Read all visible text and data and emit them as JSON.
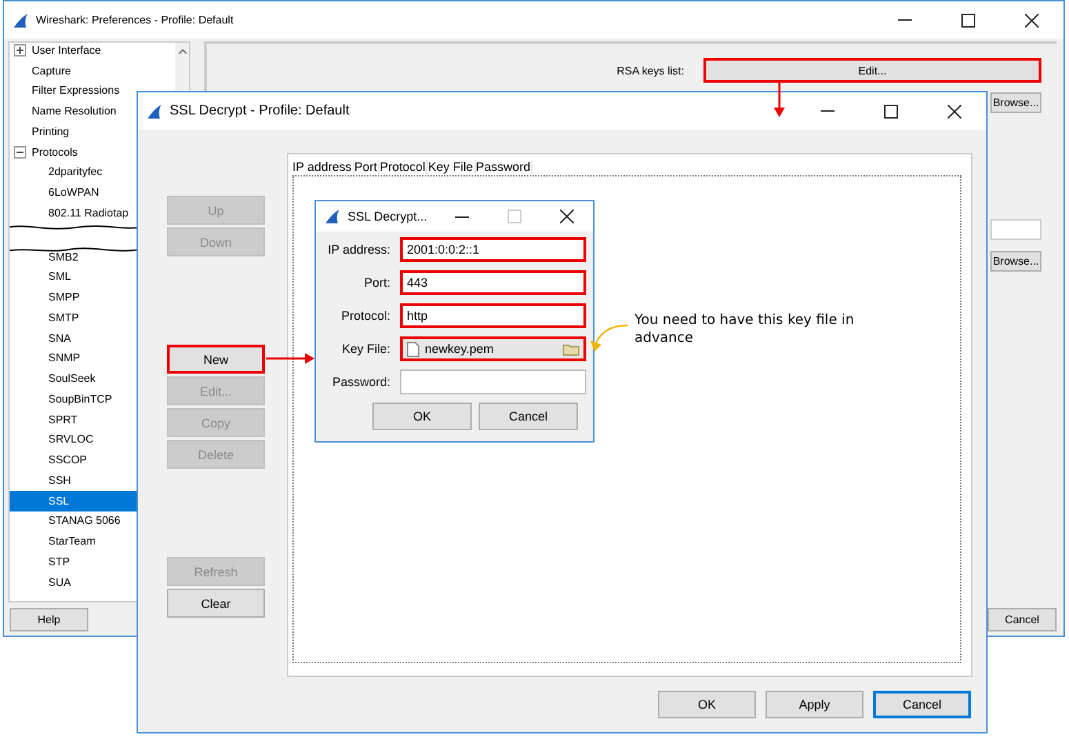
{
  "preferences_window": {
    "title": "Wireshark: Preferences - Profile: Default",
    "tree": [
      {
        "kind": "group",
        "label": "User Interface",
        "expanded": false,
        "selected": false
      },
      {
        "kind": "leaf",
        "label": "Capture",
        "selected": false
      },
      {
        "kind": "leaf",
        "label": "Filter Expressions",
        "selected": false
      },
      {
        "kind": "leaf",
        "label": "Name Resolution",
        "selected": false
      },
      {
        "kind": "leaf",
        "label": "Printing",
        "selected": false
      },
      {
        "kind": "group",
        "label": "Protocols",
        "expanded": true,
        "selected": false,
        "children": [
          {
            "kind": "leaf",
            "label": "2dparityfec",
            "selected": false
          },
          {
            "kind": "leaf",
            "label": "6LoWPAN",
            "selected": false
          },
          {
            "kind": "leaf",
            "label": "802.11 Radiotap",
            "selected": false
          },
          {
            "kind": "break"
          },
          {
            "kind": "leaf",
            "label": "SMB2",
            "selected": false
          },
          {
            "kind": "leaf",
            "label": "SML",
            "selected": false
          },
          {
            "kind": "leaf",
            "label": "SMPP",
            "selected": false
          },
          {
            "kind": "leaf",
            "label": "SMTP",
            "selected": false
          },
          {
            "kind": "leaf",
            "label": "SNA",
            "selected": false
          },
          {
            "kind": "leaf",
            "label": "SNMP",
            "selected": false
          },
          {
            "kind": "leaf",
            "label": "SoulSeek",
            "selected": false
          },
          {
            "kind": "leaf",
            "label": "SoupBinTCP",
            "selected": false
          },
          {
            "kind": "leaf",
            "label": "SPRT",
            "selected": false
          },
          {
            "kind": "leaf",
            "label": "SRVLOC",
            "selected": false
          },
          {
            "kind": "leaf",
            "label": "SSCOP",
            "selected": false
          },
          {
            "kind": "leaf",
            "label": "SSH",
            "selected": false
          },
          {
            "kind": "leaf",
            "label": "SSL",
            "selected": true
          },
          {
            "kind": "leaf",
            "label": "STANAG 5066",
            "selected": false
          },
          {
            "kind": "leaf",
            "label": "StarTeam",
            "selected": false
          },
          {
            "kind": "leaf",
            "label": "STP",
            "selected": false
          },
          {
            "kind": "leaf",
            "label": "SUA",
            "selected": false
          }
        ]
      }
    ],
    "rsa_keys_label": "RSA keys list:",
    "edit_button": {
      "label": "Edit...",
      "highlighted": true
    },
    "browse_buttons": [
      "Browse...",
      "Browse..."
    ],
    "help_button": "Help",
    "cancel_button": "Cancel"
  },
  "decrypt_window": {
    "title": "SSL Decrypt - Profile: Default",
    "columns": [
      "IP address",
      "Port",
      "Protocol",
      "Key File",
      "Password"
    ],
    "side_button_groups": [
      [
        {
          "label": "Up",
          "disabled": true,
          "highlighted": false
        },
        {
          "label": "Down",
          "disabled": true,
          "highlighted": false
        }
      ],
      [
        {
          "label": "New",
          "disabled": false,
          "highlighted": true
        },
        {
          "label": "Edit...",
          "disabled": true,
          "highlighted": false
        },
        {
          "label": "Copy",
          "disabled": true,
          "highlighted": false
        },
        {
          "label": "Delete",
          "disabled": true,
          "highlighted": false
        }
      ],
      [
        {
          "label": "Refresh",
          "disabled": true,
          "highlighted": false
        },
        {
          "label": "Clear",
          "disabled": false,
          "highlighted": false
        }
      ]
    ],
    "footer_buttons": [
      {
        "label": "OK",
        "focused": false
      },
      {
        "label": "Apply",
        "focused": false
      },
      {
        "label": "Cancel",
        "focused": true
      }
    ]
  },
  "entry_dialog": {
    "title": "SSL Decrypt...",
    "fields": [
      {
        "kind": "text",
        "label": "IP address:",
        "value": "2001:0:0:2::1",
        "highlighted": true
      },
      {
        "kind": "text",
        "label": "Port:",
        "value": "443",
        "highlighted": true
      },
      {
        "kind": "text",
        "label": "Protocol:",
        "value": "http",
        "highlighted": true
      },
      {
        "kind": "file",
        "label": "Key File:",
        "value": "newkey.pem",
        "highlighted": true
      },
      {
        "kind": "text",
        "label": "Password:",
        "highlighted": false
      }
    ],
    "buttons": [
      "OK",
      "Cancel"
    ]
  },
  "note": "You need to have this key file in advance"
}
